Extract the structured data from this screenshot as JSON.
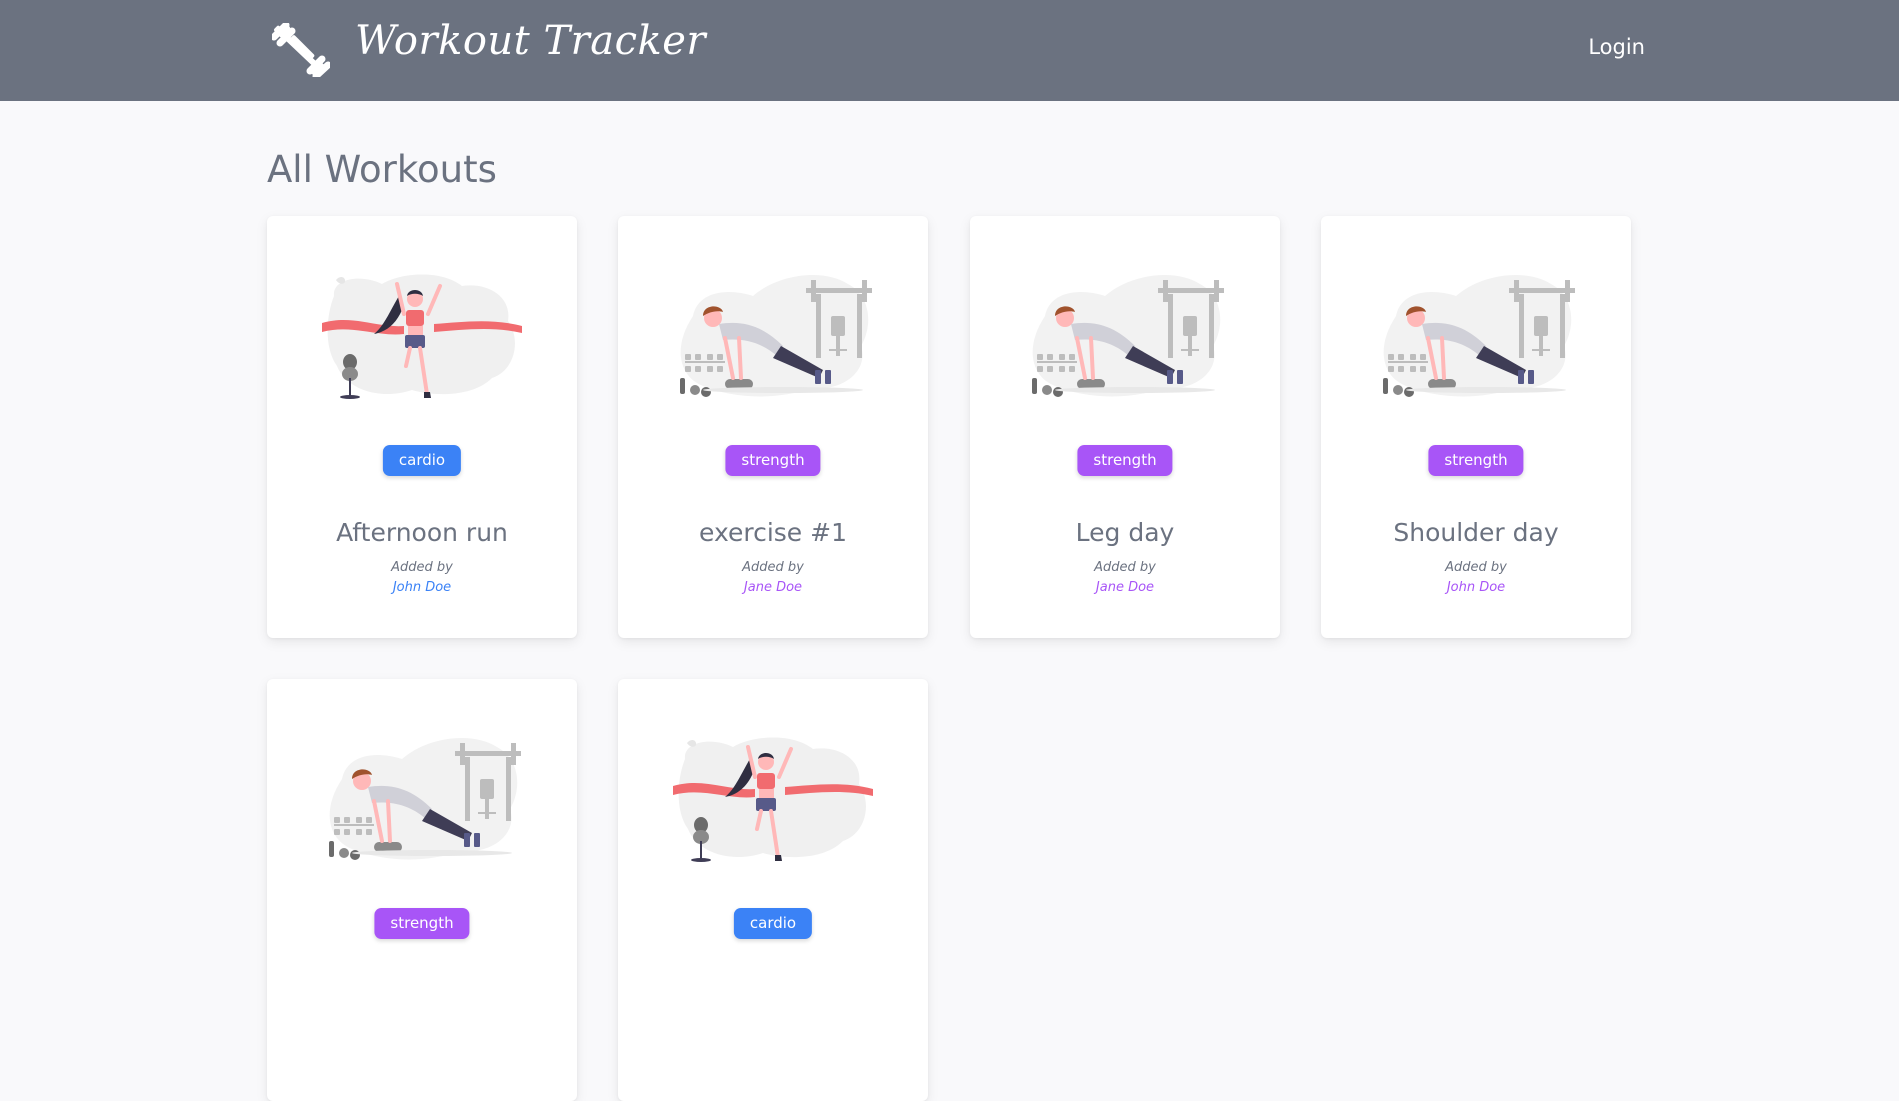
{
  "navbar": {
    "brand": "Workout Tracker",
    "login_label": "Login",
    "logo_icon": "dumbbell-icon"
  },
  "page": {
    "title": "All Workouts"
  },
  "colors": {
    "navbar_bg": "#6b7280",
    "cardio": "#3b82f6",
    "strength": "#a855f7",
    "page_bg": "#f9f9fb"
  },
  "workouts": [
    {
      "category": "cardio",
      "title": "Afternoon run",
      "added_by_label": "Added by",
      "author": "John Doe",
      "illustration": "finish-line-runner"
    },
    {
      "category": "strength",
      "title": "exercise #1",
      "added_by_label": "Added by",
      "author": "Jane Doe",
      "illustration": "pushup-gym"
    },
    {
      "category": "strength",
      "title": "Leg day",
      "added_by_label": "Added by",
      "author": "Jane Doe",
      "illustration": "pushup-gym"
    },
    {
      "category": "strength",
      "title": "Shoulder day",
      "added_by_label": "Added by",
      "author": "John Doe",
      "illustration": "pushup-gym"
    },
    {
      "category": "strength",
      "title": "",
      "added_by_label": "",
      "author": "",
      "illustration": "pushup-gym"
    },
    {
      "category": "cardio",
      "title": "",
      "added_by_label": "",
      "author": "",
      "illustration": "finish-line-runner"
    }
  ]
}
